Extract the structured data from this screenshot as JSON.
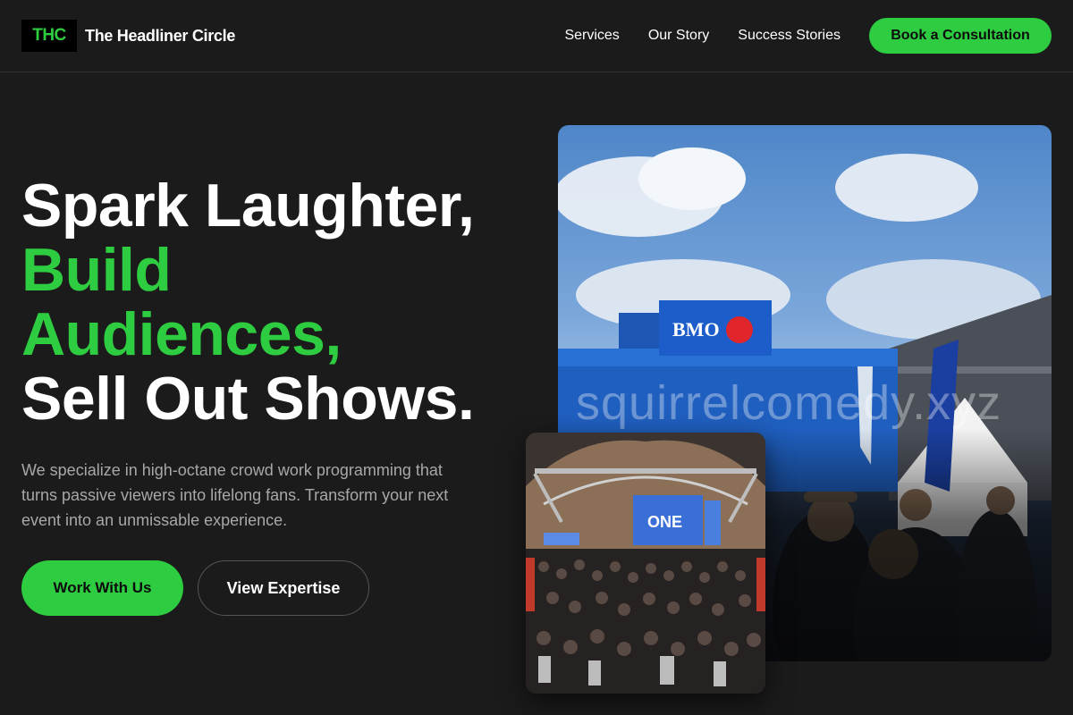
{
  "brand": {
    "badge": "THC",
    "name": "The Headliner Circle"
  },
  "nav": {
    "links": [
      "Services",
      "Our Story",
      "Success Stories"
    ],
    "cta": "Book a Consultation"
  },
  "hero": {
    "line1": "Spark Laughter,",
    "line2": "Build",
    "line3": "Audiences,",
    "line4": "Sell Out Shows.",
    "lead": "We specialize in high-octane crowd work programming that turns passive viewers into lifelong fans. Transform your next event into an unmissable experience.",
    "primary_button": "Work With Us",
    "secondary_button": "View Expertise"
  },
  "photos": {
    "main": {
      "sign_text": "BMO",
      "watermark": "squirrelcomedy.xyz"
    },
    "inset": {
      "screen_text": "ONE"
    }
  },
  "colors": {
    "accent": "#2ecc40",
    "background": "#1b1b1b",
    "muted_text": "#a8a8a8"
  }
}
